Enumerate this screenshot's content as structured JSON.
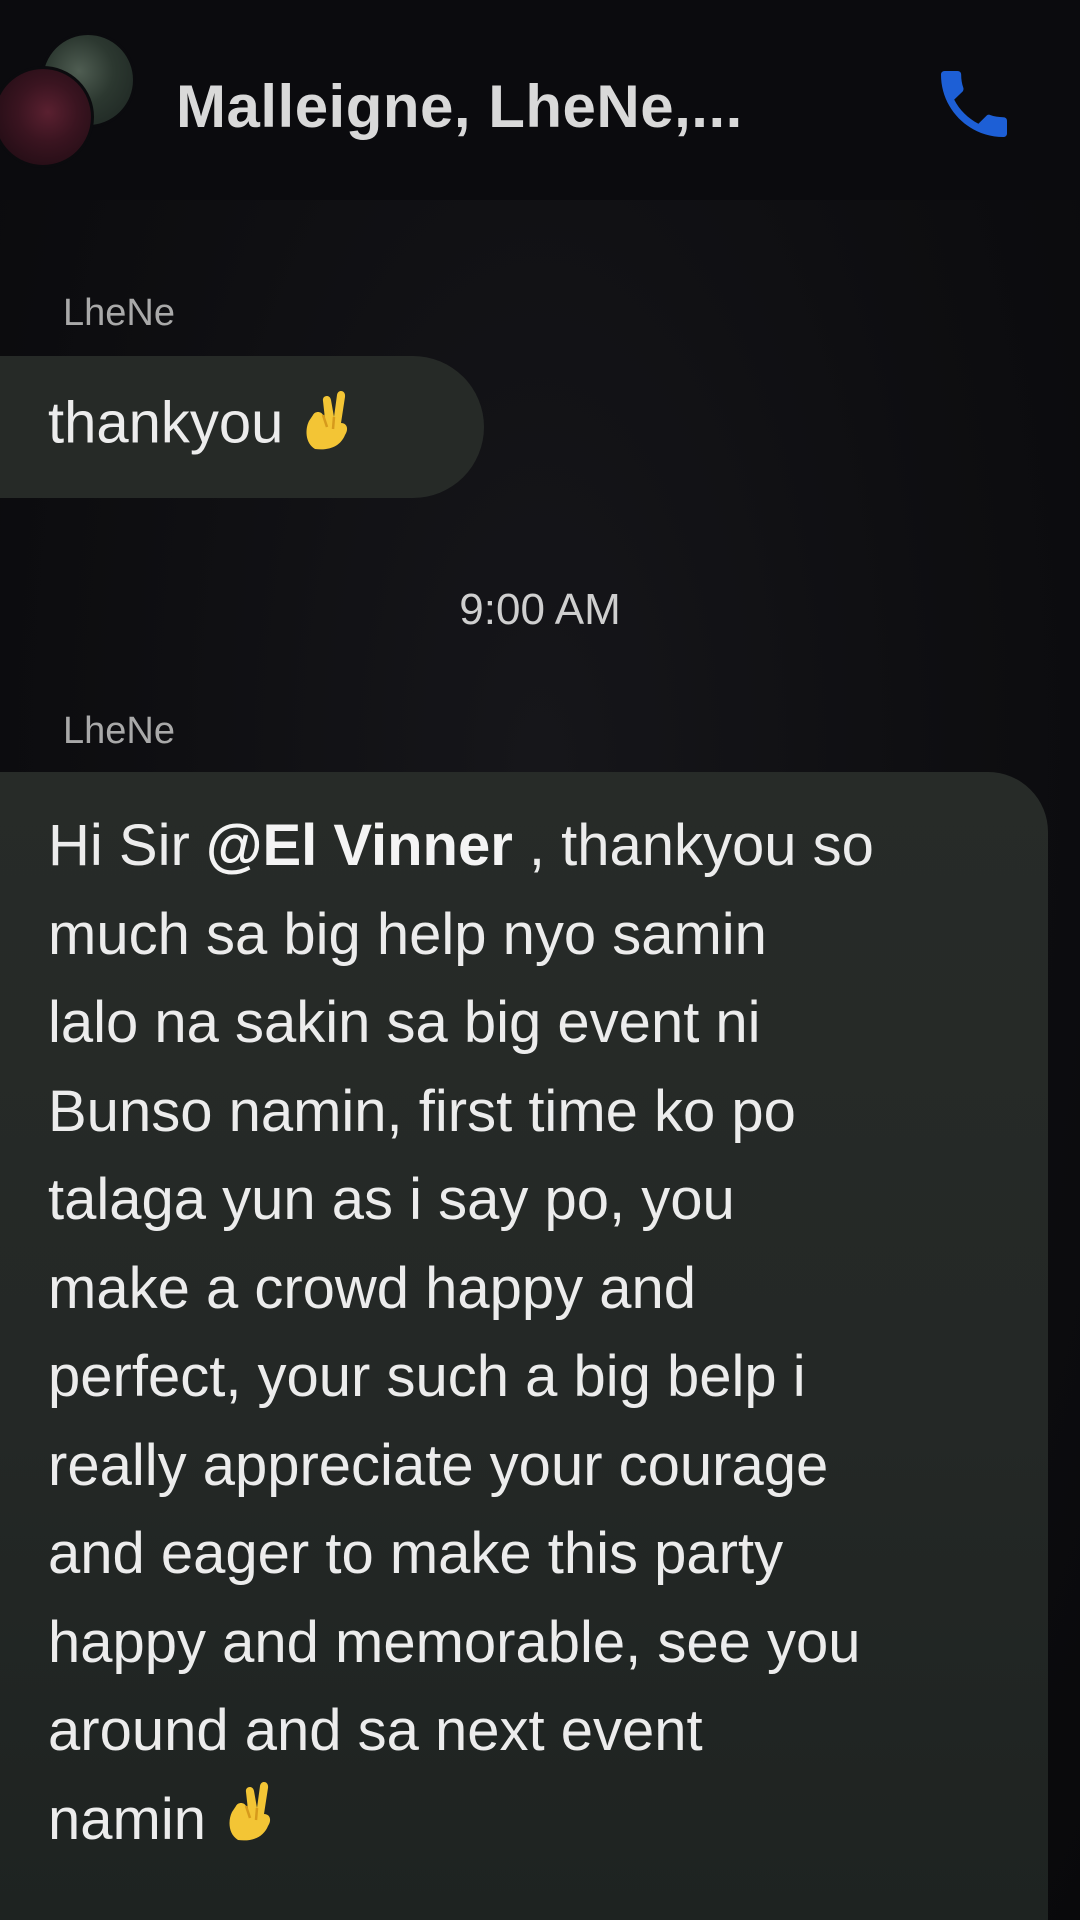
{
  "header": {
    "title": "Malleigne, LheNe,...",
    "call_icon": "phone-icon",
    "accent_color": "#1d5fd6"
  },
  "messages": [
    {
      "sender": "LheNe",
      "text": "thankyou",
      "emoji": "crossed-fingers"
    },
    {
      "time": "9:00 AM"
    },
    {
      "sender": "LheNe",
      "greeting": "Hi Sir ",
      "mention": "@El Vinner",
      "lines": [
        " , thankyou so",
        "much sa big help nyo samin",
        "lalo na sakin sa big event ni",
        "Bunso namin, first time ko po",
        "talaga yun as i say po, you",
        "make a crowd happy and",
        "perfect, your such a big belp i",
        "really appreciate your courage",
        "and eager to make this party",
        "happy and memorable, see you",
        "around and sa next event",
        "namin"
      ],
      "emoji": "crossed-fingers"
    }
  ]
}
